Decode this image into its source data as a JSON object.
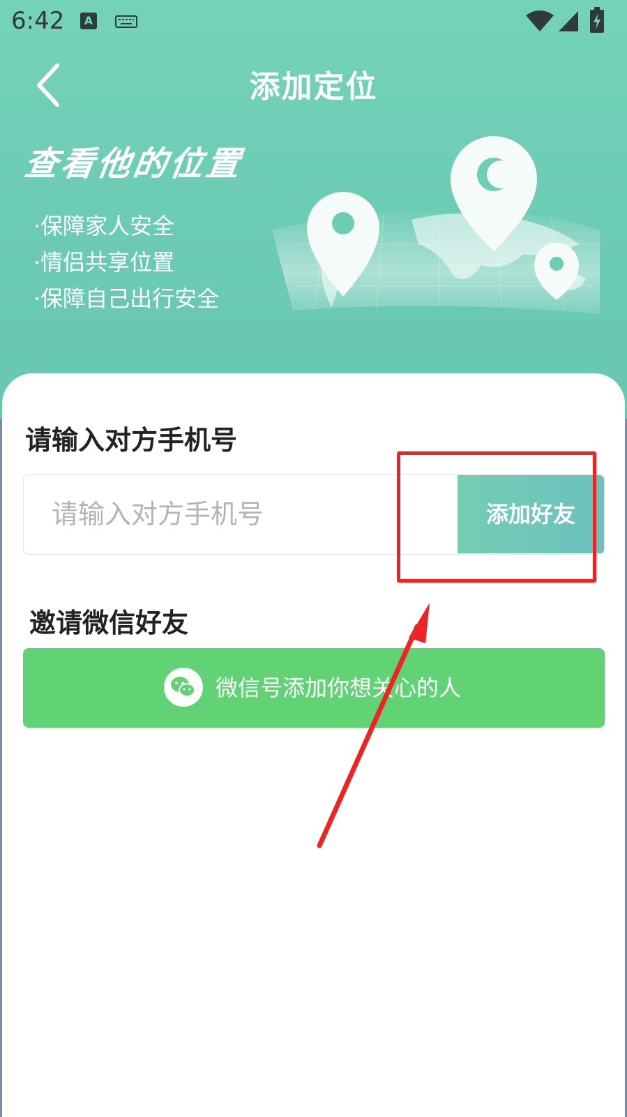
{
  "status_bar": {
    "time": "6:42",
    "input_badge": "A"
  },
  "header": {
    "title": "添加定位",
    "banner_title": "查看他的位置",
    "features": [
      "·保障家人安全",
      "·情侣共享位置",
      "·保障自己出行安全"
    ]
  },
  "phone_section": {
    "label": "请输入对方手机号",
    "input_placeholder": "请输入对方手机号",
    "input_value": "",
    "button_label": "添加好友"
  },
  "wechat_section": {
    "label": "邀请微信好友",
    "button_label": "微信号添加你想关心的人"
  },
  "icons": {
    "back": "chevron-left-icon",
    "wechat": "wechat-icon",
    "wifi": "wifi-icon",
    "signal": "signal-icon",
    "battery": "battery-charging-icon",
    "keyboard": "keyboard-icon"
  },
  "colors": {
    "header_teal": "#74d3b7",
    "add_button": "#6bc1bf",
    "wechat_green": "#62d375",
    "annotation_red": "#ee2323"
  }
}
